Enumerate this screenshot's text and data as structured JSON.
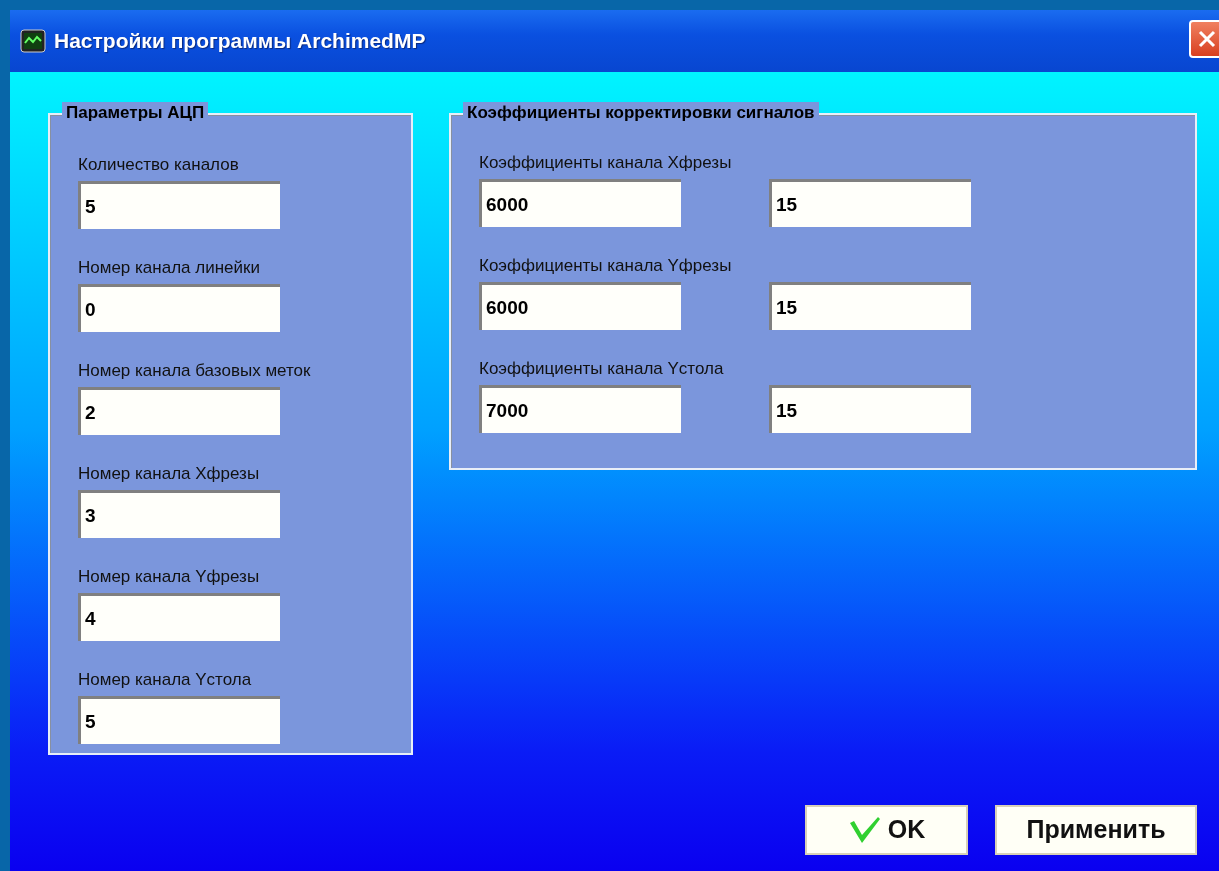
{
  "window": {
    "title": "Настройки программы ArchimedMP"
  },
  "adc_group": {
    "title": "Параметры АЦП",
    "fields": [
      {
        "label": "Количество каналов",
        "value": "5"
      },
      {
        "label": "Номер канала линейки",
        "value": "0"
      },
      {
        "label": "Номер канала базовых меток",
        "value": "2"
      },
      {
        "label": "Номер канала Хфрезы",
        "value": "3"
      },
      {
        "label": "Номер канала Yфрезы",
        "value": "4"
      },
      {
        "label": "Номер канала Yстола",
        "value": "5"
      }
    ]
  },
  "correction_group": {
    "title": "Коэффициенты корректировки сигналов",
    "fields": [
      {
        "label": "Коэффициенты канала Хфрезы",
        "value_1": "6000",
        "value_2": "15"
      },
      {
        "label": "Коэффициенты канала Yфрезы",
        "value_1": "6000",
        "value_2": "15"
      },
      {
        "label": "Коэффициенты канала Yстола",
        "value_1": "7000",
        "value_2": "15"
      }
    ]
  },
  "buttons": [
    {
      "label": "OK",
      "kind": "ok"
    },
    {
      "label": "Применить",
      "kind": "plain"
    }
  ]
}
